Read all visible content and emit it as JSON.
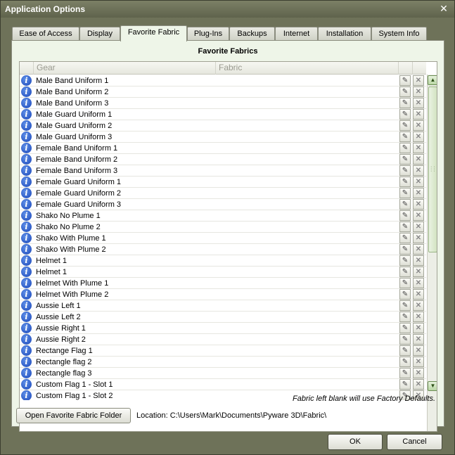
{
  "window": {
    "title": "Application Options"
  },
  "tabs": [
    {
      "label": "Ease of Access"
    },
    {
      "label": "Display"
    },
    {
      "label": "Favorite Fabric"
    },
    {
      "label": "Plug-Ins"
    },
    {
      "label": "Backups"
    },
    {
      "label": "Internet"
    },
    {
      "label": "Installation"
    },
    {
      "label": "System Info"
    }
  ],
  "active_tab": "Favorite Fabric",
  "panel": {
    "title": "Favorite Fabrics",
    "columns": {
      "gear": "Gear",
      "fabric": "Fabric"
    },
    "rows": [
      {
        "gear": "Male Band Uniform 1",
        "fabric": ""
      },
      {
        "gear": "Male Band Uniform 2",
        "fabric": ""
      },
      {
        "gear": "Male Band Uniform 3",
        "fabric": ""
      },
      {
        "gear": "Male Guard Uniform 1",
        "fabric": ""
      },
      {
        "gear": "Male Guard Uniform 2",
        "fabric": ""
      },
      {
        "gear": "Male Guard Uniform 3",
        "fabric": ""
      },
      {
        "gear": "Female Band Uniform 1",
        "fabric": ""
      },
      {
        "gear": "Female Band Uniform 2",
        "fabric": ""
      },
      {
        "gear": "Female Band Uniform 3",
        "fabric": ""
      },
      {
        "gear": "Female Guard Uniform 1",
        "fabric": ""
      },
      {
        "gear": "Female Guard Uniform 2",
        "fabric": ""
      },
      {
        "gear": "Female Guard Uniform 3",
        "fabric": ""
      },
      {
        "gear": "Shako No Plume 1",
        "fabric": ""
      },
      {
        "gear": "Shako No Plume 2",
        "fabric": ""
      },
      {
        "gear": "Shako With Plume 1",
        "fabric": ""
      },
      {
        "gear": "Shako With Plume 2",
        "fabric": ""
      },
      {
        "gear": "Helmet 1",
        "fabric": ""
      },
      {
        "gear": "Helmet 1",
        "fabric": ""
      },
      {
        "gear": "Helmet With Plume 1",
        "fabric": ""
      },
      {
        "gear": "Helmet With Plume 2",
        "fabric": ""
      },
      {
        "gear": "Aussie Left 1",
        "fabric": ""
      },
      {
        "gear": "Aussie Left 2",
        "fabric": ""
      },
      {
        "gear": "Aussie Right 1",
        "fabric": ""
      },
      {
        "gear": "Aussie Right 2",
        "fabric": ""
      },
      {
        "gear": "Rectange Flag 1",
        "fabric": ""
      },
      {
        "gear": "Rectangle flag 2",
        "fabric": ""
      },
      {
        "gear": "Rectangle flag 3",
        "fabric": ""
      },
      {
        "gear": "Custom Flag 1 - Slot 1",
        "fabric": ""
      },
      {
        "gear": "Custom Flag 1 - Slot 2",
        "fabric": ""
      }
    ],
    "footnote": "Fabric left blank will use Factory Defaults.",
    "open_folder_label": "Open Favorite Fabric Folder",
    "location": "Location: C:\\Users\\Mark\\Documents\\Pyware 3D\\Fabric\\"
  },
  "icons": {
    "info": "info-icon",
    "edit": "pencil-icon",
    "clear": "x-icon",
    "close": "close-icon",
    "scroll_up": "chevron-up-icon",
    "scroll_down": "chevron-down-icon"
  },
  "glyphs": {
    "info": "i",
    "edit": "✎",
    "clear": "✕",
    "close": "✕",
    "up": "▲",
    "down": "▼"
  },
  "buttons": {
    "ok": "OK",
    "cancel": "Cancel"
  },
  "colors": {
    "frame": "#6e7259",
    "panel": "#eef5e8",
    "info_icon": "#1a46b8"
  }
}
